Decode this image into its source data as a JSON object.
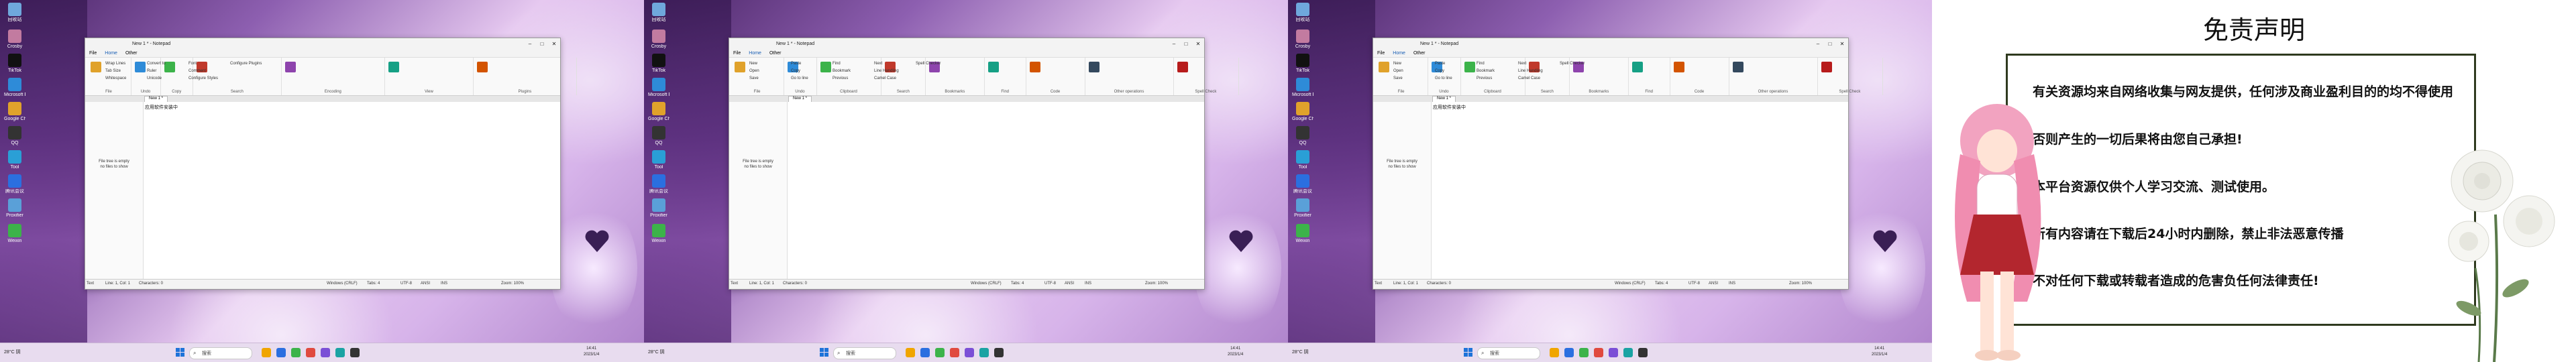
{
  "desktop_icons": [
    {
      "label": "回收站",
      "color": "#6fa8dc"
    },
    {
      "label": "Crosby",
      "color": "#c27ba0"
    },
    {
      "label": "TikTok",
      "color": "#111111"
    },
    {
      "label": "Microsoft Edge",
      "color": "#2e8bd8"
    },
    {
      "label": "Google Chrome",
      "color": "#e0a22b"
    },
    {
      "label": "QQ",
      "color": "#333333"
    },
    {
      "label": "Tool",
      "color": "#2a9fd6"
    },
    {
      "label": "腾讯会议",
      "color": "#2b6fe0"
    },
    {
      "label": "Proxifier",
      "color": "#5aa0d8"
    },
    {
      "label": "Weixin",
      "color": "#3cb34a"
    }
  ],
  "panels": [
    {
      "title": "New 1 * - Notepad",
      "tabs": [
        "File",
        "Home",
        "Other"
      ],
      "active_tab": "Home",
      "doc_tab": "New 1 *",
      "editor_text": "应用软件安装中",
      "groups": [
        "File",
        "Undo",
        "Copy",
        "Search",
        "Encoding",
        "View",
        "Plugins"
      ],
      "ribbon_labels": [
        "Wrap Lines",
        "Tab Size",
        "Whitespace",
        "Convert to",
        "Ruler",
        "Unicode",
        "Font",
        "Comment",
        "Configure Styles",
        "Configure Plugins"
      ],
      "status": [
        "Text",
        "Line: 1, Col: 1",
        "Characters: 0",
        "Windows (CRLF)",
        "Tabs: 4",
        "UTF-8",
        "ANSI",
        "INS",
        "Zoom: 100%"
      ]
    },
    {
      "title": "New 1 * - Notepad",
      "tabs": [
        "File",
        "Home",
        "Other"
      ],
      "active_tab": "Home",
      "doc_tab": "New 1 *",
      "editor_text": "",
      "groups": [
        "File",
        "Undo",
        "Clipboard",
        "Search",
        "Bookmarks",
        "Find",
        "Code",
        "Other operations",
        "Spell Check"
      ],
      "ribbon_labels": [
        "New",
        "Open",
        "Save",
        "Paste",
        "Copy",
        "Go to line",
        "Find",
        "Bookmark",
        "Previous",
        "Next",
        "Line Handling",
        "Camel Case",
        "Spell Checker"
      ],
      "status": [
        "Text",
        "Line: 1, Col: 1",
        "Characters: 0",
        "Windows (CRLF)",
        "Tabs: 4",
        "UTF-8",
        "ANSI",
        "INS",
        "Zoom: 100%"
      ]
    },
    {
      "title": "New 1 * - Notepad",
      "tabs": [
        "File",
        "Home",
        "Other"
      ],
      "active_tab": "Home",
      "doc_tab": "New 1 *",
      "editor_text": "应用软件安装中",
      "groups": [
        "File",
        "Undo",
        "Clipboard",
        "Search",
        "Bookmarks",
        "Find",
        "Code",
        "Other operations",
        "Spell Check"
      ],
      "ribbon_labels": [
        "New",
        "Open",
        "Save",
        "Paste",
        "Copy",
        "Go to line",
        "Find",
        "Bookmark",
        "Previous",
        "Next",
        "Line Handling",
        "Camel Case",
        "Spell Checker"
      ],
      "status": [
        "Text",
        "Line: 1, Col: 1",
        "Characters: 0",
        "Windows (CRLF)",
        "Tabs: 4",
        "UTF-8",
        "ANSI",
        "INS",
        "Zoom: 100%"
      ]
    }
  ],
  "filetree_empty": [
    "File tree is empty",
    "no files to show"
  ],
  "taskbar": {
    "search_placeholder": "搜索",
    "weather": "28°C 阴",
    "times": [
      {
        "time": "14:41",
        "date": "2023/1/4"
      },
      {
        "time": "14:41",
        "date": "2023/1/4"
      },
      {
        "time": "14:41",
        "date": "2023/1/4"
      }
    ]
  },
  "disclaimer": {
    "title": "免责声明",
    "paragraphs": [
      "有关资源均来自网络收集与网友提供，任何涉及商业盈利目的的均不得使用",
      "否则产生的一切后果将由您自己承担!",
      "本平台资源仅供个人学习交流、测试使用。",
      "所有内容请在下载后24小时内删除，禁止非法恶意传播",
      "不对任何下载或转载者造成的危害负任何法律责任!"
    ]
  }
}
